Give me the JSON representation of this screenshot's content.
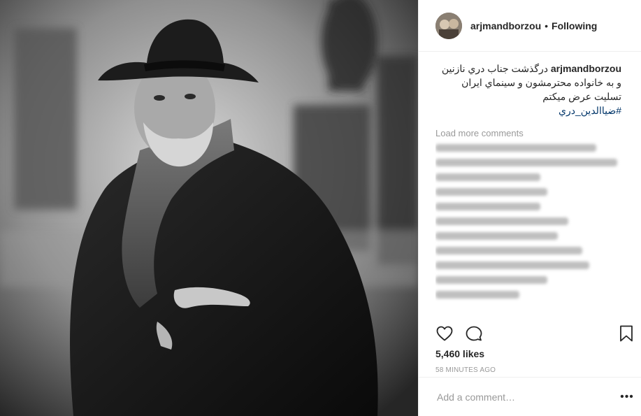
{
  "post": {
    "username": "arjmandborzou",
    "separator": "•",
    "follow_status": "Following",
    "caption": {
      "username": "arjmandborzou",
      "text": "درگذشت جناب دري نازنين و به خانواده محترمشون و سينماي ايران تسليت عرض ميكتم",
      "hashtag": "#ضياالدين_دري"
    },
    "load_more": "Load more comments",
    "likes": "5,460 likes",
    "time": "58 MINUTES AGO",
    "add_comment_placeholder": "Add a comment…",
    "more_options": "•••"
  },
  "icons": {
    "like": "heart-icon",
    "comment": "comment-icon",
    "save": "bookmark-icon",
    "more": "more-options-icon"
  },
  "colors": {
    "text": "#262626",
    "secondary": "#999999",
    "hashtag": "#003569",
    "border": "#efefef"
  }
}
